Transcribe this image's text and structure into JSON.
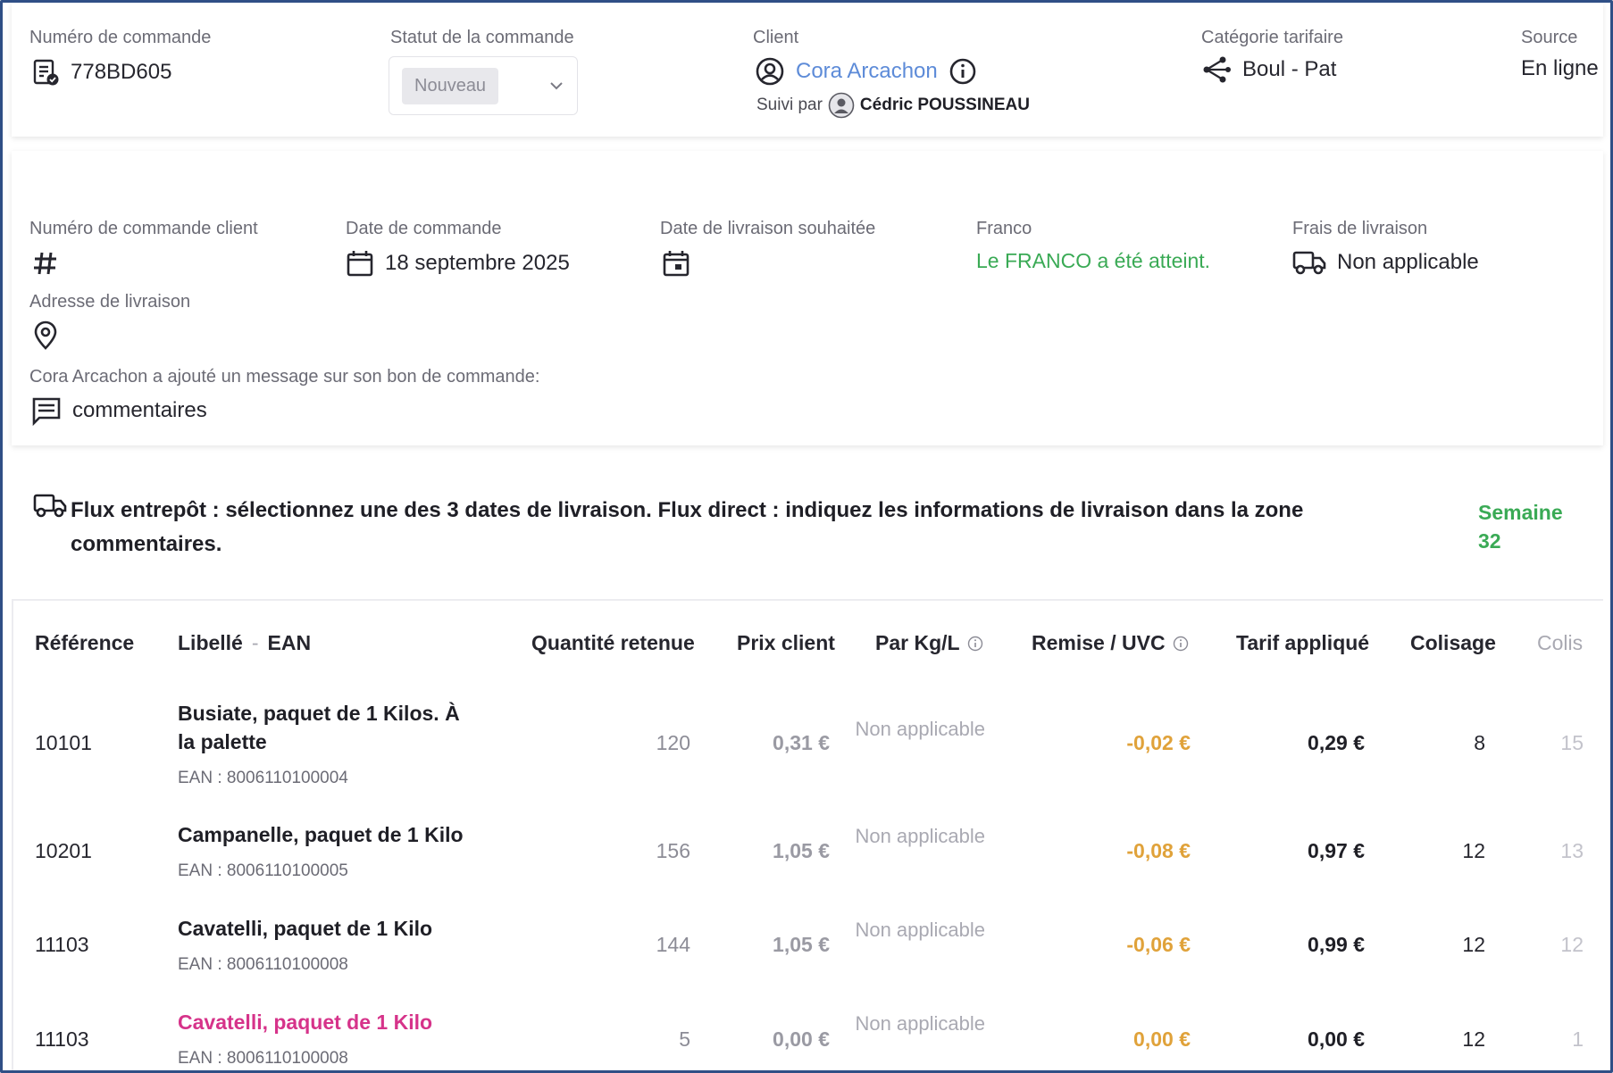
{
  "header": {
    "order_number_label": "Numéro de commande",
    "order_number": "778BD605",
    "status_label": "Statut de la commande",
    "status_value": "Nouveau",
    "client_label": "Client",
    "client_name": "Cora Arcachon",
    "followed_by_label": "Suivi par",
    "followed_by_name": "Cédric POUSSINEAU",
    "tariff_label": "Catégorie tarifaire",
    "tariff_value": "Boul - Pat",
    "source_label": "Source",
    "source_value": "En ligne"
  },
  "details": {
    "client_order_label": "Numéro de commande client",
    "order_date_label": "Date de commande",
    "order_date": "18 septembre 2025",
    "delivery_date_label": "Date de livraison souhaitée",
    "franco_label": "Franco",
    "franco_value": "Le FRANCO a été atteint.",
    "delivery_fee_label": "Frais de livraison",
    "delivery_fee_value": "Non applicable",
    "address_label": "Adresse de livraison",
    "message_label": "Cora Arcachon a ajouté un message sur son bon de commande:",
    "message_value": "commentaires"
  },
  "banner": {
    "text": "Flux entrepôt : sélectionnez une des 3 dates de livraison. Flux direct : indiquez les informations de livraison dans la zone commentaires.",
    "week_label": "Semaine",
    "week_number": "32"
  },
  "table": {
    "headers": {
      "reference": "Référence",
      "libelle": "Libellé",
      "sep": "-",
      "ean": "EAN",
      "quantite": "Quantité retenue",
      "prix": "Prix client",
      "parkg": "Par Kg/L",
      "remise": "Remise / UVC",
      "tarif": "Tarif appliqué",
      "colisage": "Colisage",
      "colis": "Colis"
    },
    "rows": [
      {
        "ref": "10101",
        "libelle": "Busiate, paquet de 1 Kilos. À la palette",
        "ean": "EAN : 8006110100004",
        "qty": "120",
        "prix": "0,31 €",
        "parkg": "Non applicable",
        "remise": "-0,02 €",
        "tarif": "0,29 €",
        "colisage": "8",
        "colis": "15"
      },
      {
        "ref": "10201",
        "libelle": "Campanelle, paquet de 1 Kilo",
        "ean": "EAN : 8006110100005",
        "qty": "156",
        "prix": "1,05 €",
        "parkg": "Non applicable",
        "remise": "-0,08 €",
        "tarif": "0,97 €",
        "colisage": "12",
        "colis": "13"
      },
      {
        "ref": "11103",
        "libelle": "Cavatelli, paquet de 1 Kilo",
        "ean": "EAN : 8006110100008",
        "qty": "144",
        "prix": "1,05 €",
        "parkg": "Non applicable",
        "remise": "-0,06 €",
        "tarif": "0,99 €",
        "colisage": "12",
        "colis": "12"
      },
      {
        "ref": "11103",
        "libelle": "Cavatelli, paquet de 1 Kilo",
        "ean": "EAN : 8006110100008",
        "qty": "5",
        "prix": "0,00 €",
        "parkg": "Non applicable",
        "remise": "0,00 €",
        "tarif": "0,00 €",
        "colisage": "12",
        "colis": "1"
      }
    ]
  },
  "colors": {
    "link": "#5d8bd8",
    "success": "#3aaa55",
    "discount": "#e0a23a",
    "highlight": "#d6338a",
    "frame": "#2f4f86"
  }
}
